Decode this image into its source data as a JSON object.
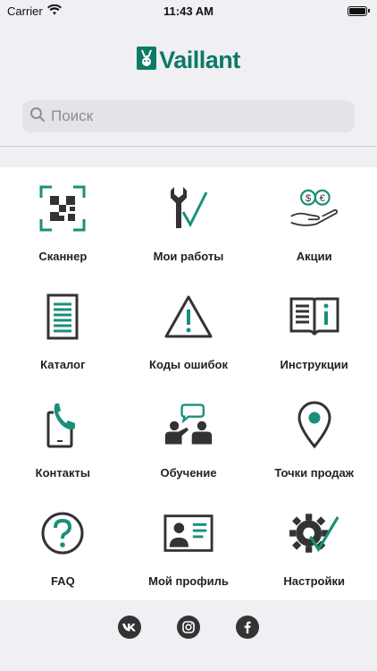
{
  "status": {
    "carrier": "Carrier",
    "time": "11:43 AM"
  },
  "brand": {
    "name": "Vaillant",
    "color": "#0d7a65"
  },
  "search": {
    "placeholder": "Поиск"
  },
  "accent": "#1a8f7a",
  "tiles": [
    {
      "label": "Сканнер",
      "icon": "qr-scanner-icon"
    },
    {
      "label": "Мои работы",
      "icon": "wrench-check-icon"
    },
    {
      "label": "Акции",
      "icon": "money-hand-icon"
    },
    {
      "label": "Каталог",
      "icon": "catalog-icon"
    },
    {
      "label": "Коды ошибок",
      "icon": "warning-icon"
    },
    {
      "label": "Инструкции",
      "icon": "manual-book-icon"
    },
    {
      "label": "Контакты",
      "icon": "phone-icon"
    },
    {
      "label": "Обучение",
      "icon": "training-icon"
    },
    {
      "label": "Точки продаж",
      "icon": "map-pin-icon"
    },
    {
      "label": "FAQ",
      "icon": "question-icon"
    },
    {
      "label": "Мой профиль",
      "icon": "profile-card-icon"
    },
    {
      "label": "Настройки",
      "icon": "settings-gear-check-icon"
    }
  ],
  "social": [
    {
      "label": "vk",
      "icon": "vk-icon"
    },
    {
      "label": "instagram",
      "icon": "instagram-icon"
    },
    {
      "label": "facebook",
      "icon": "facebook-icon"
    }
  ]
}
